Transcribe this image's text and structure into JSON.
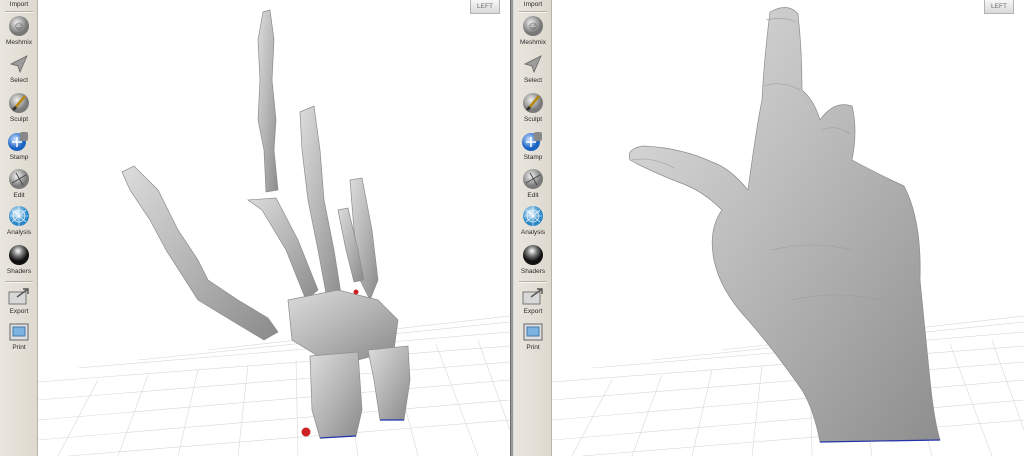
{
  "panels": [
    {
      "id": "left",
      "subject": "hand-bones",
      "view_cube_label": "LEFT",
      "tools": [
        {
          "label": "Import",
          "icon": "import-icon"
        },
        {
          "label": "Meshmix",
          "icon": "meshmix-icon"
        },
        {
          "label": "Select",
          "icon": "select-arrow-icon"
        },
        {
          "label": "Sculpt",
          "icon": "sculpt-brush-icon"
        },
        {
          "label": "Stamp",
          "icon": "stamp-icon"
        },
        {
          "label": "Edit",
          "icon": "edit-icon"
        },
        {
          "label": "Analysis",
          "icon": "analysis-sphere-icon"
        },
        {
          "label": "Shaders",
          "icon": "shaders-sphere-icon"
        },
        {
          "label": "Export",
          "icon": "export-icon"
        },
        {
          "label": "Print",
          "icon": "print-icon"
        }
      ]
    },
    {
      "id": "right",
      "subject": "hand-skin",
      "view_cube_label": "LEFT",
      "tools": [
        {
          "label": "Import",
          "icon": "import-icon"
        },
        {
          "label": "Meshmix",
          "icon": "meshmix-icon"
        },
        {
          "label": "Select",
          "icon": "select-arrow-icon"
        },
        {
          "label": "Sculpt",
          "icon": "sculpt-brush-icon"
        },
        {
          "label": "Stamp",
          "icon": "stamp-icon"
        },
        {
          "label": "Edit",
          "icon": "edit-icon"
        },
        {
          "label": "Analysis",
          "icon": "analysis-sphere-icon"
        },
        {
          "label": "Shaders",
          "icon": "shaders-sphere-icon"
        },
        {
          "label": "Export",
          "icon": "export-icon"
        },
        {
          "label": "Print",
          "icon": "print-icon"
        }
      ]
    }
  ],
  "colors": {
    "toolbar_bg": "#e6e2d9",
    "model_gray": "#b9b9b9",
    "grid_line": "#d8d8d8",
    "base_edge": "#2233aa",
    "marker_red": "#cc2222"
  }
}
